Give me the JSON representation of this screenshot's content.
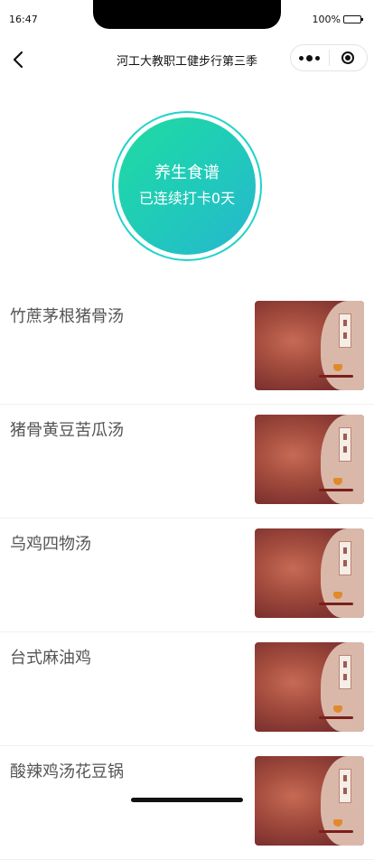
{
  "status_bar": {
    "time": "16:47",
    "battery": "100%"
  },
  "nav": {
    "title": "河工大教职工健步行第三季",
    "back_icon": "chevron-left-icon",
    "more_icon": "more-dots-icon",
    "close_icon": "target-circle-icon"
  },
  "hero": {
    "title": "养生食谱",
    "subtitle": "已连续打卡0天",
    "colors": {
      "ring": "#1ed3c9",
      "gradient_start": "#20dba0",
      "gradient_end": "#27b7cf"
    }
  },
  "recipes": [
    {
      "title": "竹蔗茅根猪骨汤",
      "thumb": "recipe-cover-image"
    },
    {
      "title": "猪骨黄豆苦瓜汤",
      "thumb": "recipe-cover-image"
    },
    {
      "title": "乌鸡四物汤",
      "thumb": "recipe-cover-image"
    },
    {
      "title": "台式麻油鸡",
      "thumb": "recipe-cover-image"
    },
    {
      "title": "酸辣鸡汤花豆锅",
      "thumb": "recipe-cover-image"
    }
  ]
}
